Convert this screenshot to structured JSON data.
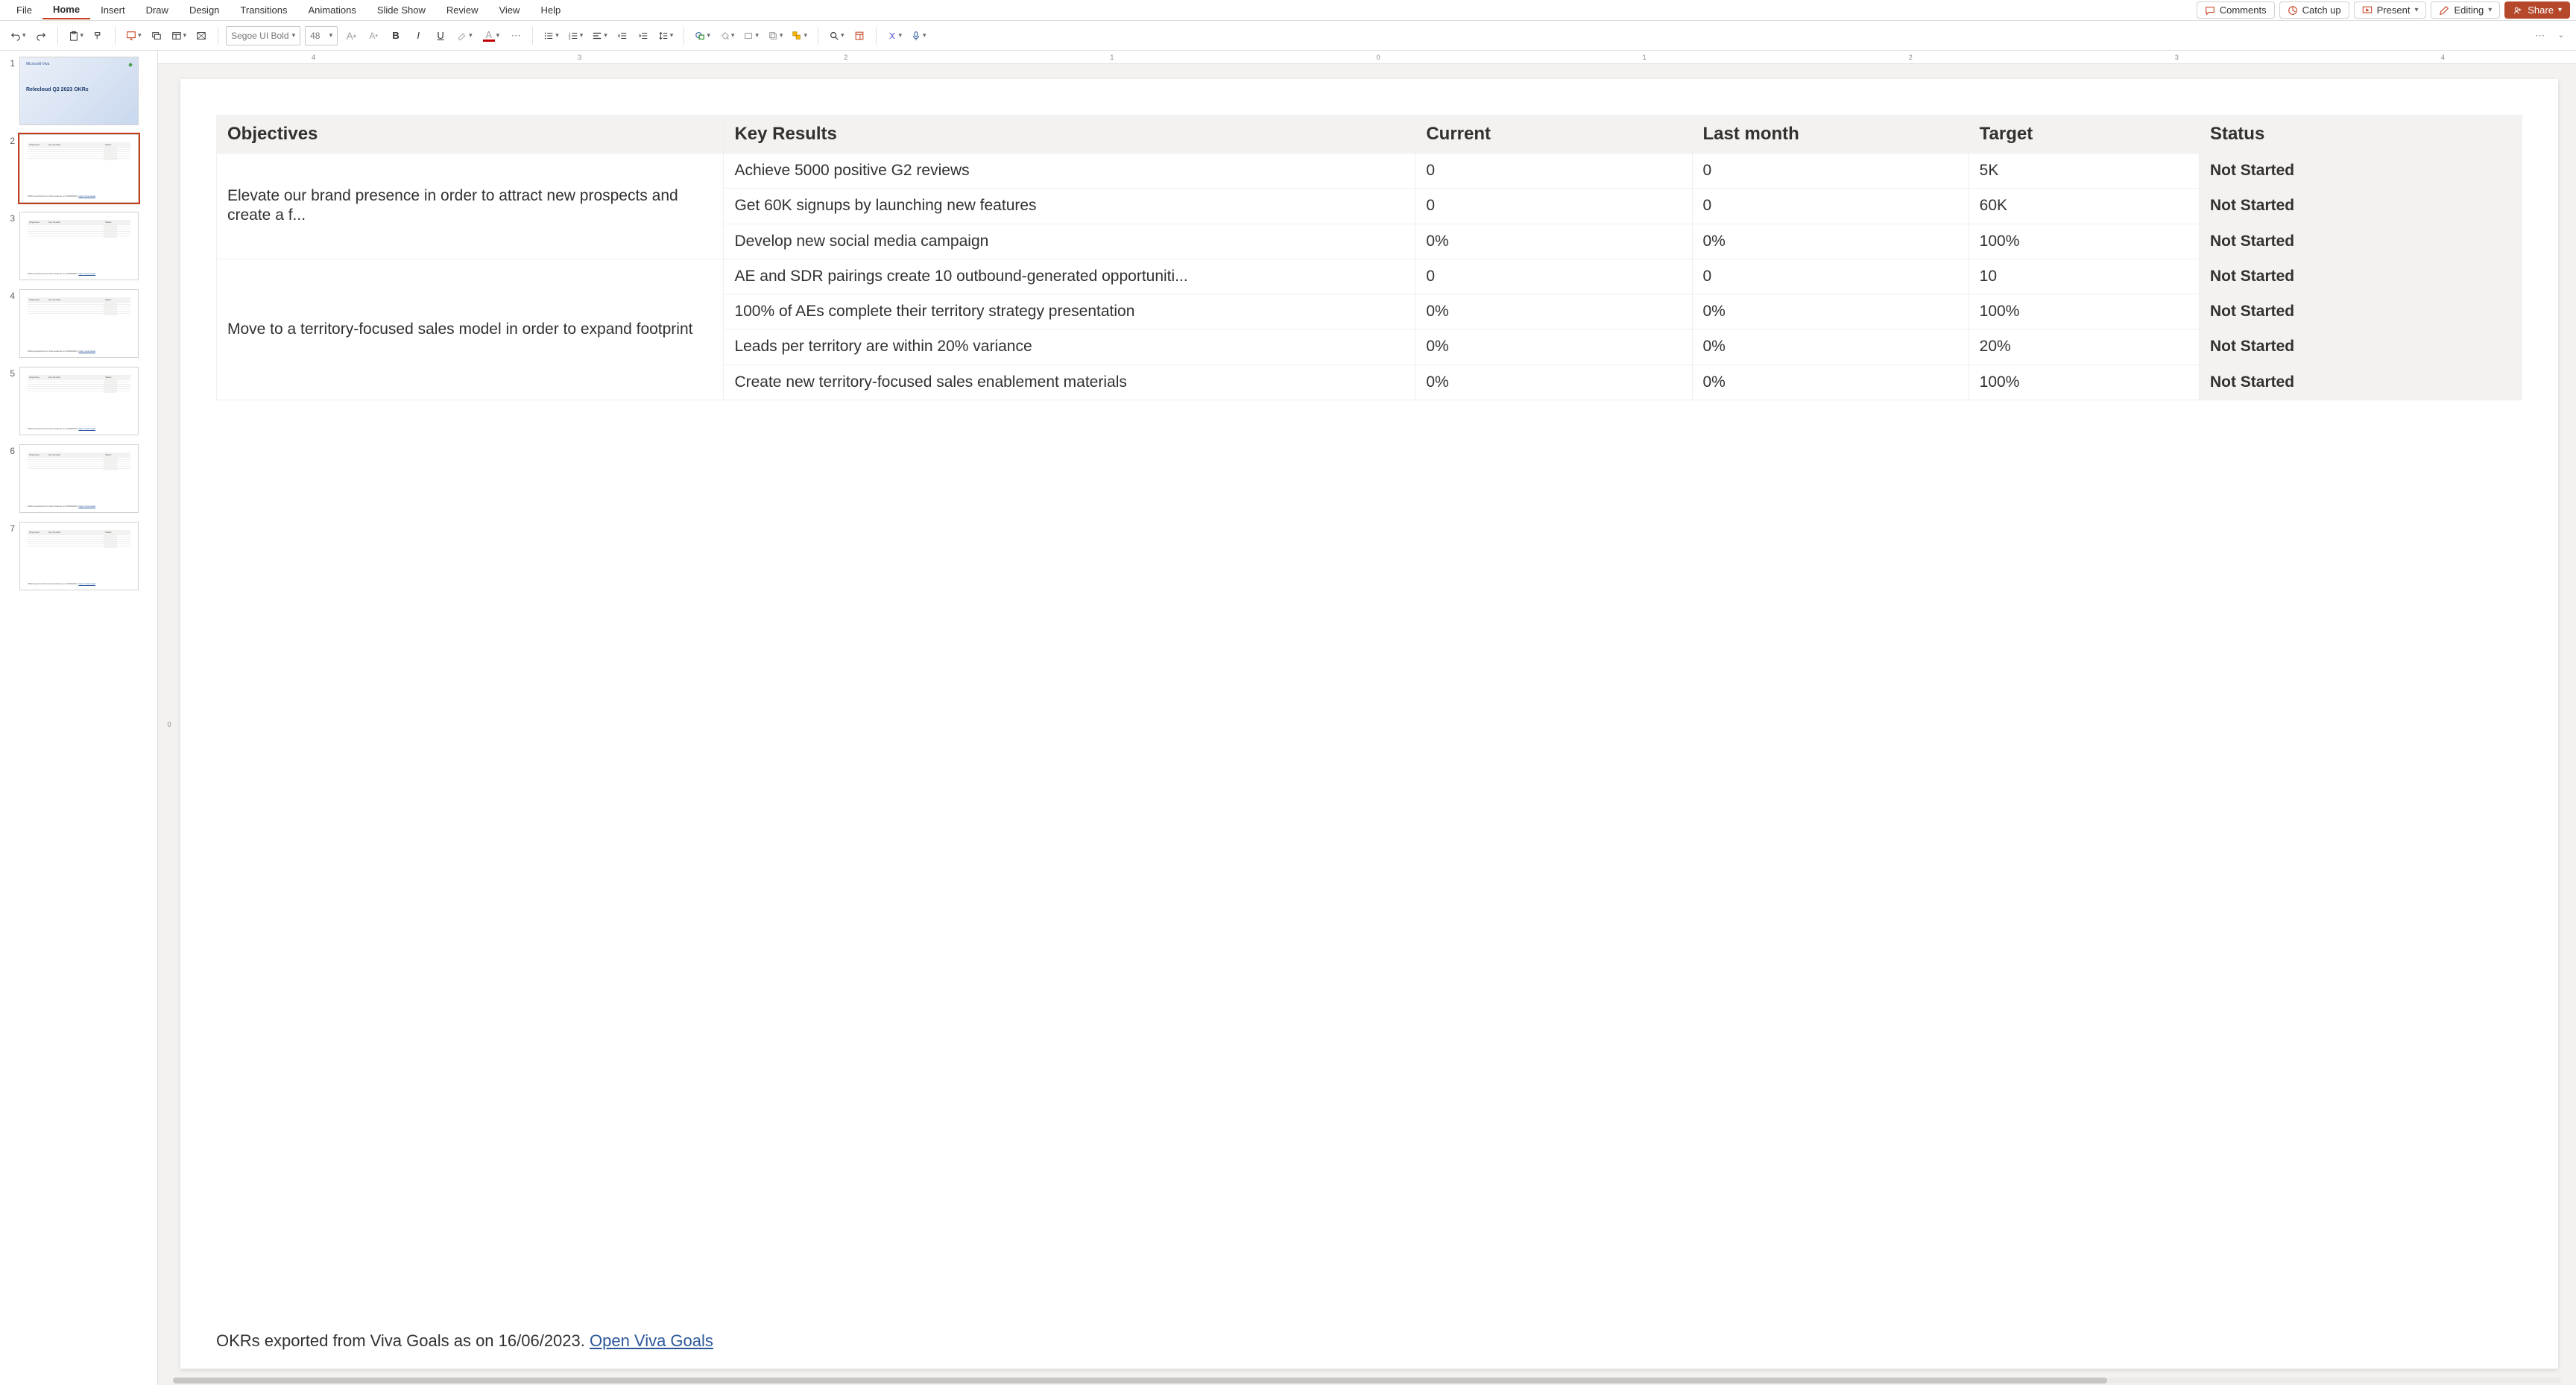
{
  "menu": {
    "tabs": [
      "File",
      "Home",
      "Insert",
      "Draw",
      "Design",
      "Transitions",
      "Animations",
      "Slide Show",
      "Review",
      "View",
      "Help"
    ],
    "active": 1,
    "comments": "Comments",
    "catchup": "Catch up",
    "present": "Present",
    "editing": "Editing",
    "share": "Share"
  },
  "ribbon": {
    "font_name": "Segoe UI Bold",
    "font_size": "48"
  },
  "ruler_h": [
    "4",
    "3",
    "2",
    "1",
    "0",
    "1",
    "2",
    "3",
    "4"
  ],
  "ruler_v": [
    "",
    "0",
    ""
  ],
  "thumbs": [
    {
      "n": "1",
      "title": "Relecloud Q2 2023 OKRs",
      "kind": "title"
    },
    {
      "n": "2",
      "kind": "table",
      "selected": true
    },
    {
      "n": "3",
      "kind": "table"
    },
    {
      "n": "4",
      "kind": "table"
    },
    {
      "n": "5",
      "kind": "table"
    },
    {
      "n": "6",
      "kind": "table"
    },
    {
      "n": "7",
      "kind": "table"
    }
  ],
  "table": {
    "headers": [
      "Objectives",
      "Key Results",
      "Current",
      "Last month",
      "Target",
      "Status"
    ],
    "groups": [
      {
        "objective": "Elevate our brand presence in order to attract new prospects and create a f...",
        "rows": [
          {
            "kr": "Achieve 5000 positive G2 reviews",
            "cur": "0",
            "lm": "0",
            "tg": "5K",
            "st": "Not Started"
          },
          {
            "kr": "Get 60K signups by launching new features",
            "cur": "0",
            "lm": "0",
            "tg": "60K",
            "st": "Not Started"
          },
          {
            "kr": "Develop new social media campaign",
            "cur": "0%",
            "lm": "0%",
            "tg": "100%",
            "st": "Not Started"
          }
        ]
      },
      {
        "objective": "Move to a territory-focused sales model in order to expand footprint",
        "rows": [
          {
            "kr": "AE and SDR pairings create 10 outbound-generated opportuniti...",
            "cur": "0",
            "lm": "0",
            "tg": "10",
            "st": "Not Started"
          },
          {
            "kr": "100% of AEs complete their territory strategy presentation",
            "cur": "0%",
            "lm": "0%",
            "tg": "100%",
            "st": "Not Started"
          },
          {
            "kr": "Leads per territory are within 20% variance",
            "cur": "0%",
            "lm": "0%",
            "tg": "20%",
            "st": "Not Started"
          },
          {
            "kr": "Create new territory-focused sales enablement materials",
            "cur": "0%",
            "lm": "0%",
            "tg": "100%",
            "st": "Not Started"
          }
        ]
      }
    ]
  },
  "footer": {
    "text": "OKRs exported from Viva Goals as on 16/06/2023. ",
    "link": "Open Viva Goals"
  }
}
